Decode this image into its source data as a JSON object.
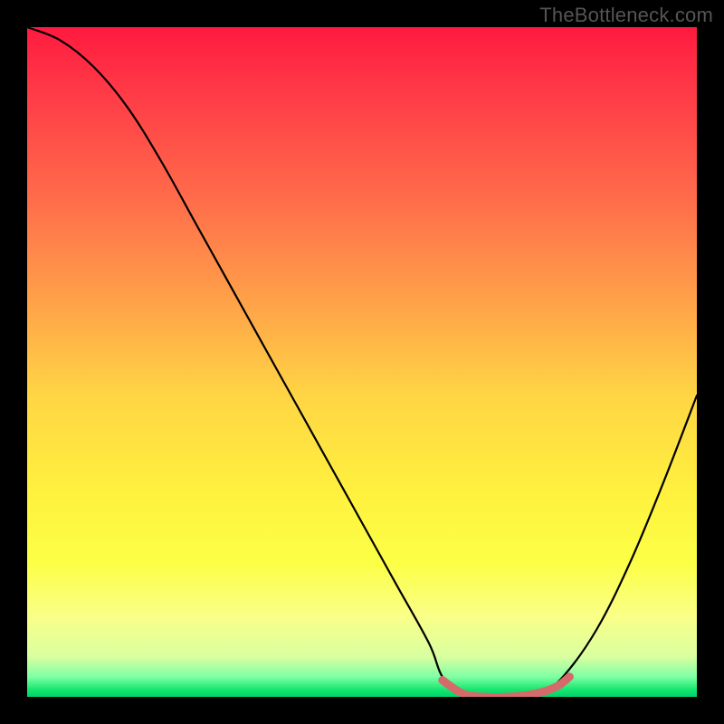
{
  "attribution": "TheBottleneck.com",
  "chart_data": {
    "type": "line",
    "title": "",
    "xlabel": "",
    "ylabel": "",
    "xlim": [
      0,
      100
    ],
    "ylim": [
      0,
      100
    ],
    "x": [
      0,
      5,
      10,
      15,
      20,
      25,
      30,
      35,
      40,
      45,
      50,
      55,
      60,
      62,
      65,
      68,
      72,
      76,
      80,
      85,
      90,
      95,
      100
    ],
    "values": [
      100,
      98,
      94,
      88,
      80,
      71,
      62,
      53,
      44,
      35,
      26,
      17,
      8,
      3,
      0,
      0,
      0,
      0,
      3,
      10,
      20,
      32,
      45
    ],
    "series": [
      {
        "name": "bottleneck-curve",
        "color": "#000000"
      },
      {
        "name": "optimal-range-marker",
        "color": "#d46a6a",
        "x": [
          62,
          65,
          68,
          72,
          76,
          79,
          81
        ],
        "values": [
          2.5,
          0.5,
          0,
          0,
          0.5,
          1.5,
          3
        ]
      }
    ],
    "gradient_stops": [
      {
        "pos": 0,
        "color": "#ff1a3f"
      },
      {
        "pos": 10,
        "color": "#ff3b47"
      },
      {
        "pos": 25,
        "color": "#ff6a4a"
      },
      {
        "pos": 40,
        "color": "#ff9e49"
      },
      {
        "pos": 55,
        "color": "#ffd544"
      },
      {
        "pos": 70,
        "color": "#fff23e"
      },
      {
        "pos": 80,
        "color": "#fcff46"
      },
      {
        "pos": 88,
        "color": "#faff88"
      },
      {
        "pos": 94,
        "color": "#d9ffa0"
      },
      {
        "pos": 97,
        "color": "#7fffa5"
      },
      {
        "pos": 99,
        "color": "#12e66c"
      },
      {
        "pos": 100,
        "color": "#00d26f"
      }
    ]
  }
}
